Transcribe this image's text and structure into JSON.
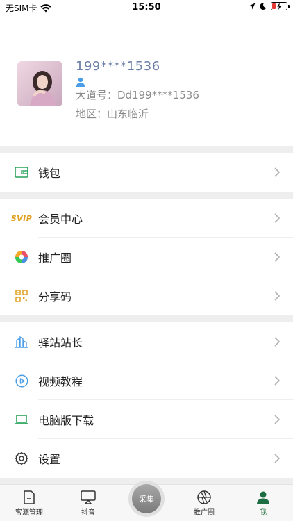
{
  "status_bar": {
    "carrier": "无SIM卡",
    "time": "15:50"
  },
  "profile": {
    "phone": "199****1536",
    "dadao_id": "大道号：Dd199****1536",
    "region": "地区：山东临沂"
  },
  "menu": {
    "wallet": "钱包",
    "member_center": "会员中心",
    "svip_badge": "SVIP",
    "promo_circle": "推广圈",
    "share_code": "分享码",
    "station_master": "驿站站长",
    "video_tutorial": "视频教程",
    "pc_download": "电脑版下载",
    "settings": "设置"
  },
  "tabbar": {
    "customer": "客源管理",
    "douyin": "抖音",
    "collect": "采集",
    "promo": "推广圈",
    "me": "我",
    "active_color": "#1f6e43"
  }
}
